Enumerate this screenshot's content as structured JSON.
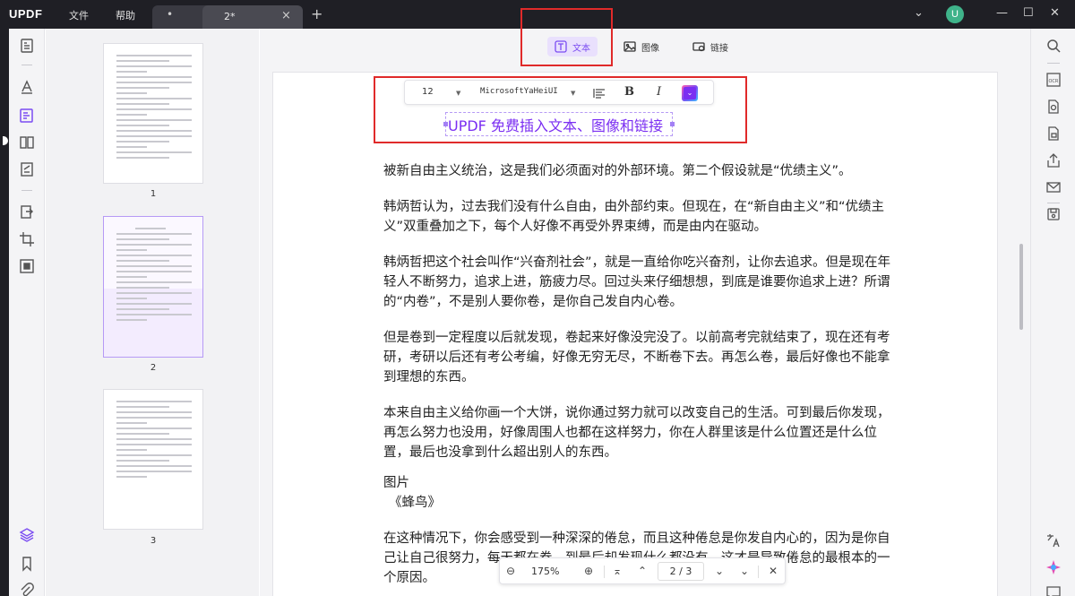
{
  "app": {
    "logo_text": "UPDF",
    "menu": {
      "file": "文件",
      "help": "帮助"
    },
    "tabs": [
      {
        "label": "•",
        "active": false
      },
      {
        "label": "2*",
        "active": true,
        "close": "×"
      }
    ],
    "add_tab": "+",
    "avatar_letter": "U",
    "window_controls": {
      "expand": "⌄",
      "minimize": "—",
      "maximize": "☐",
      "close": "✕"
    }
  },
  "left_toolbar": {
    "icons": [
      "reader-icon",
      "comment-icon",
      "edit-text-icon",
      "organize-pages-icon",
      "fill-sign-icon",
      "convert-icon",
      "crop-icon",
      "redact-icon",
      "layers-icon",
      "bookmark-icon",
      "attachment-icon"
    ],
    "active": "edit-text-icon"
  },
  "thumbnails": {
    "pages": [
      {
        "label": "1",
        "selected": false
      },
      {
        "label": "2",
        "selected": true
      },
      {
        "label": "3",
        "selected": false
      }
    ]
  },
  "mode_bar": {
    "text_label": "文本",
    "image_label": "图像",
    "link_label": "链接",
    "active": "text"
  },
  "format_toolbar": {
    "font_size": "12",
    "font_name": "MicrosoftYaHeiUI",
    "bold": "B",
    "italic": "I",
    "color": "#7b2ff2"
  },
  "inserted_text": "UPDF 免费插入文本、图像和链接",
  "body": {
    "paragraphs": [
      "被新自由主义统治，这是我们必须面对的外部环境。第二个假设就是“优绩主义”。",
      "韩炳哲认为，过去我们没有什么自由，由外部约束。但现在，在“新自由主义”和“优绩主义”双重叠加之下，每个人好像不再受外界束缚，而是由内在驱动。",
      "韩炳哲把这个社会叫作“兴奋剂社会”，就是一直给你吃兴奋剂，让你去追求。但是现在年轻人不断努力，追求上进，筋疲力尽。回过头来仔细想想，到底是谁要你追求上进？所谓的“内卷”，不是别人要你卷，是你自己发自内心卷。",
      "但是卷到一定程度以后就发现，卷起来好像没完没了。以前高考完就结束了，现在还有考研，考研以后还有考公考编，好像无穷无尽，不断卷下去。再怎么卷，最后好像也不能拿到理想的东西。",
      "本来自由主义给你画一个大饼，说你通过努力就可以改变自己的生活。可到最后你发现，再怎么努力也没用，好像周围人也都在这样努力，你在人群里该是什么位置还是什么位置，最后也没拿到什么超出别人的东西。"
    ],
    "section_title": "图片",
    "section_sub": "《蜂鸟》",
    "last_paragraph": "在这种情况下，你会感受到一种深深的倦怠，而且这种倦怠是你发自内心的，因为是你自己让自己很努力，每天都在卷，到最后却发现什么都没有，这才是导致倦怠的最根本的一个原因。"
  },
  "zoom_bar": {
    "zoom_out": "⊖",
    "zoom_value": "175%",
    "zoom_in": "⊕",
    "first_page": "⌅",
    "prev_page": "⌃",
    "page_indicator": "2 / 3",
    "next_page": "⌄",
    "last_page": "⌄",
    "close": "✕"
  },
  "right_toolbar": {
    "icons": [
      "search-icon",
      "ocr-icon",
      "convert-file-icon",
      "protect-icon",
      "share-icon",
      "email-icon",
      "save-icon",
      "translate-icon",
      "ai-assistant-icon",
      "chat-icon"
    ]
  },
  "colors": {
    "accent": "#7b4cf2",
    "highlight_box": "#e02a2a",
    "titlebar": "#1f1f25"
  }
}
